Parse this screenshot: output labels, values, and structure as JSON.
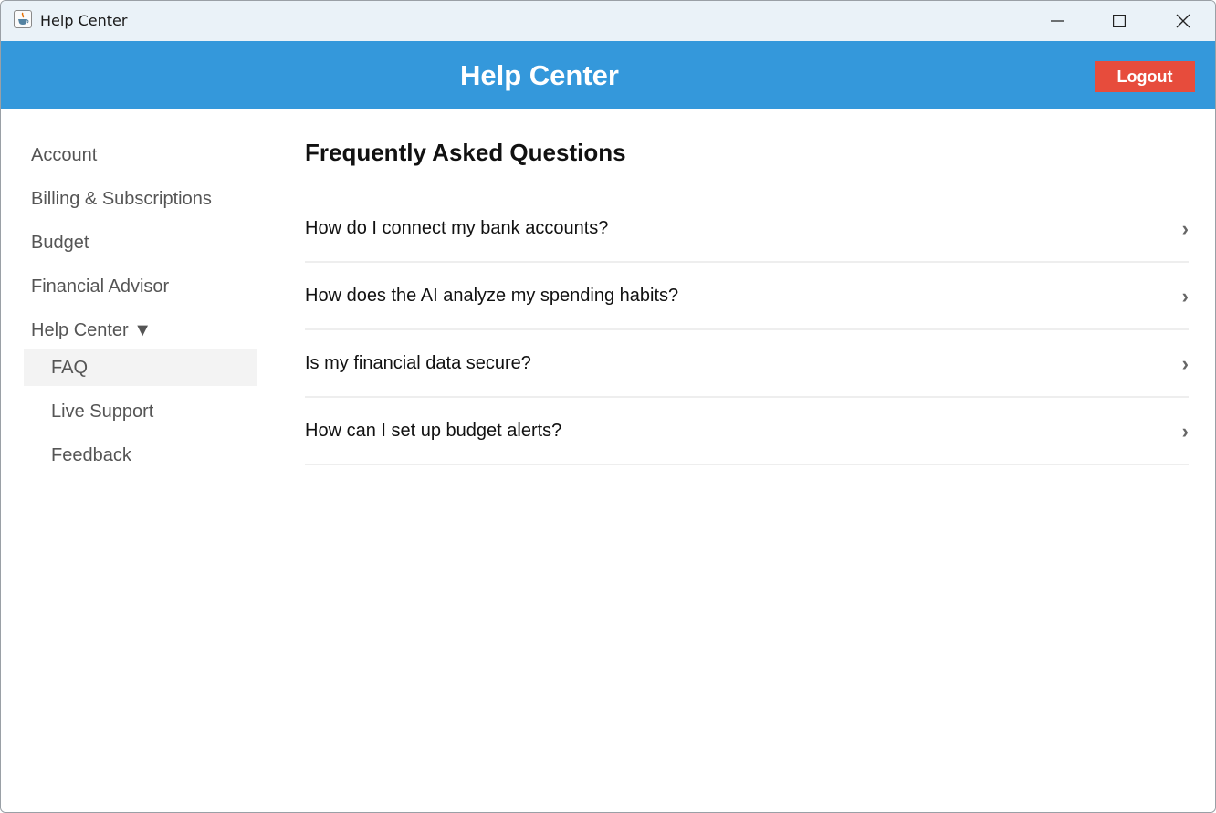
{
  "window": {
    "title": "Help Center"
  },
  "header": {
    "title": "Help Center",
    "logout_label": "Logout"
  },
  "sidebar": {
    "items": [
      {
        "label": "Account"
      },
      {
        "label": "Billing & Subscriptions"
      },
      {
        "label": "Budget"
      },
      {
        "label": "Financial Advisor"
      },
      {
        "label": "Help Center ▼"
      }
    ],
    "subitems": [
      {
        "label": "FAQ",
        "active": true
      },
      {
        "label": "Live Support",
        "active": false
      },
      {
        "label": "Feedback",
        "active": false
      }
    ]
  },
  "main": {
    "title": "Frequently Asked Questions",
    "faqs": [
      {
        "question": "How do I connect my bank accounts?",
        "chevron": "›"
      },
      {
        "question": "How does the AI analyze my spending habits?",
        "chevron": "›"
      },
      {
        "question": "Is my financial data secure?",
        "chevron": "›"
      },
      {
        "question": "How can I set up budget alerts?",
        "chevron": "›"
      }
    ]
  },
  "colors": {
    "header_bg": "#3498db",
    "logout_bg": "#e74c3c",
    "titlebar_bg": "#eaf2f8",
    "active_sub_bg": "#f3f3f3"
  },
  "icons": {
    "app": "java-cup-icon",
    "minimize": "minimize-icon",
    "maximize": "maximize-icon",
    "close": "close-icon",
    "faq_chevron": "chevron-right-icon"
  }
}
